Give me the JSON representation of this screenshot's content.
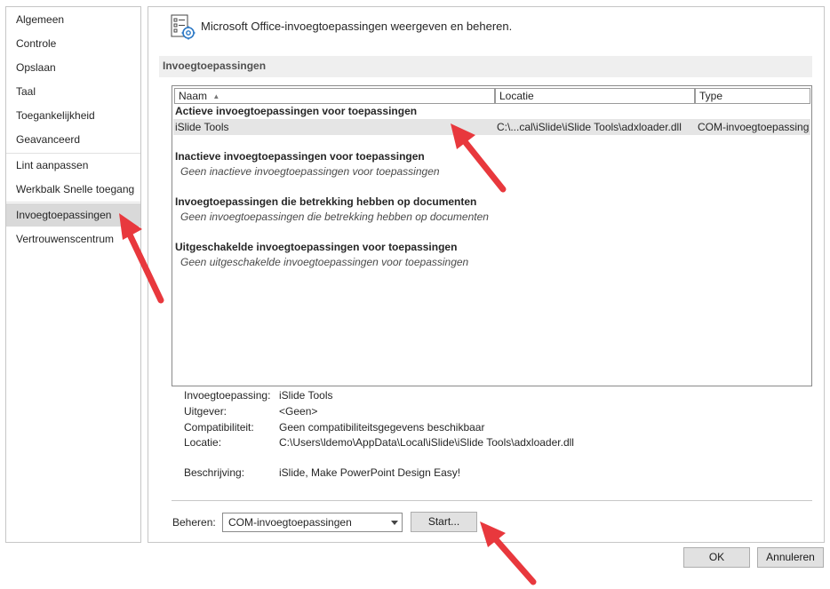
{
  "nav": {
    "items": [
      {
        "label": "Algemeen"
      },
      {
        "label": "Controle"
      },
      {
        "label": "Opslaan"
      },
      {
        "label": "Taal"
      },
      {
        "label": "Toegankelijkheid"
      },
      {
        "label": "Geavanceerd"
      },
      {
        "label": "Lint aanpassen"
      },
      {
        "label": "Werkbalk Snelle toegang"
      },
      {
        "label": "Invoegtoepassingen",
        "selected": true
      },
      {
        "label": "Vertrouwenscentrum"
      }
    ]
  },
  "header": {
    "title": "Microsoft Office-invoegtoepassingen weergeven en beheren.",
    "icon": "addins-settings-icon"
  },
  "section": {
    "title": "Invoegtoepassingen"
  },
  "list": {
    "columns": [
      "Naam",
      "Locatie",
      "Type"
    ],
    "sort_indicator": "▲",
    "groups": [
      {
        "title": "Actieve invoegtoepassingen voor toepassingen",
        "rows": [
          {
            "name": "iSlide Tools",
            "location": "C:\\...cal\\iSlide\\iSlide Tools\\adxloader.dll",
            "type": "COM-invoegtoepassing"
          }
        ]
      },
      {
        "title": "Inactieve invoegtoepassingen voor toepassingen",
        "empty": "Geen inactieve invoegtoepassingen voor toepassingen"
      },
      {
        "title": "Invoegtoepassingen die betrekking hebben op documenten",
        "empty": "Geen invoegtoepassingen die betrekking hebben op documenten"
      },
      {
        "title": "Uitgeschakelde invoegtoepassingen voor toepassingen",
        "empty": "Geen uitgeschakelde invoegtoepassingen voor toepassingen"
      }
    ]
  },
  "details": {
    "addin_label": "Invoegtoepassing:",
    "addin_value": "iSlide Tools",
    "publisher_label": "Uitgever:",
    "publisher_value": "<Geen>",
    "compat_label": "Compatibiliteit:",
    "compat_value": "Geen compatibiliteitsgegevens beschikbaar",
    "location_label": "Locatie:",
    "location_value": "C:\\Users\\ldemo\\AppData\\Local\\iSlide\\iSlide Tools\\adxloader.dll",
    "description_label": "Beschrijving:",
    "description_value": "iSlide, Make PowerPoint Design Easy!"
  },
  "manage": {
    "label": "Beheren:",
    "selected": "COM-invoegtoepassingen",
    "start_button": "Start..."
  },
  "footer": {
    "ok": "OK",
    "cancel": "Annuleren"
  },
  "annotation_color": "#e8383d"
}
